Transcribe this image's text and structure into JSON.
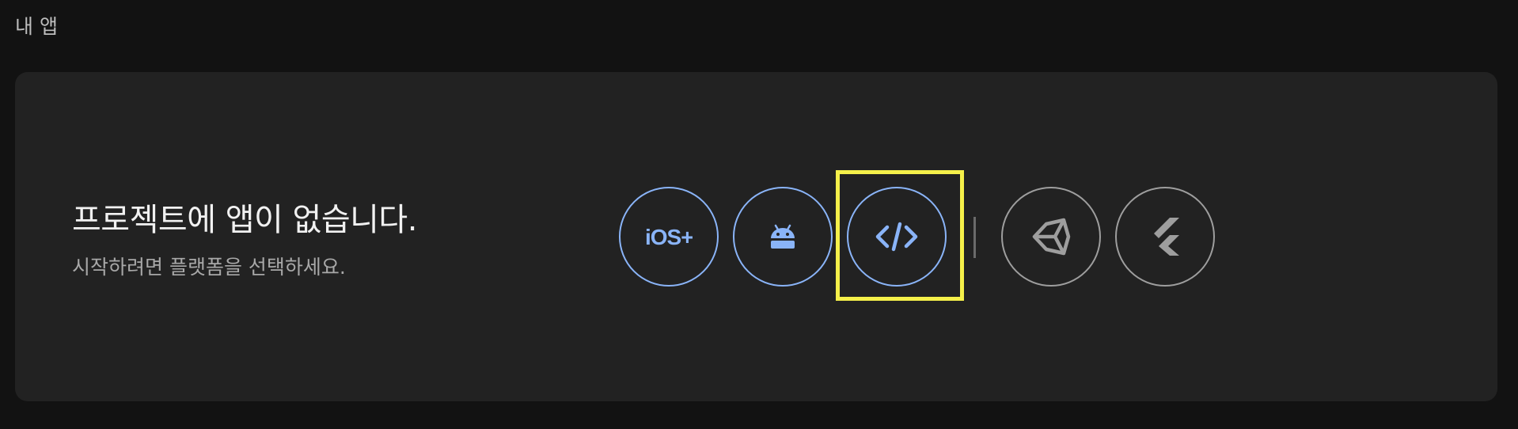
{
  "header": {
    "title": "내 앱"
  },
  "empty_state": {
    "title": "프로젝트에 앱이 없습니다.",
    "subtitle": "시작하려면 플랫폼을 선택하세요."
  },
  "platforms": [
    {
      "id": "ios",
      "icon": "ios-plus-icon",
      "color": "#8ab4f8",
      "text": "iOS+"
    },
    {
      "id": "android",
      "icon": "android-icon",
      "color": "#8ab4f8"
    },
    {
      "id": "web",
      "icon": "code-icon",
      "color": "#8ab4f8",
      "highlighted": true
    },
    {
      "id": "unity",
      "icon": "unity-icon",
      "color": "#9e9e9e"
    },
    {
      "id": "flutter",
      "icon": "flutter-icon",
      "color": "#9e9e9e"
    }
  ],
  "colors": {
    "background": "#121212",
    "card": "#222222",
    "accent": "#8ab4f8",
    "muted_icon": "#9e9e9e",
    "highlight": "#f5f04a"
  }
}
